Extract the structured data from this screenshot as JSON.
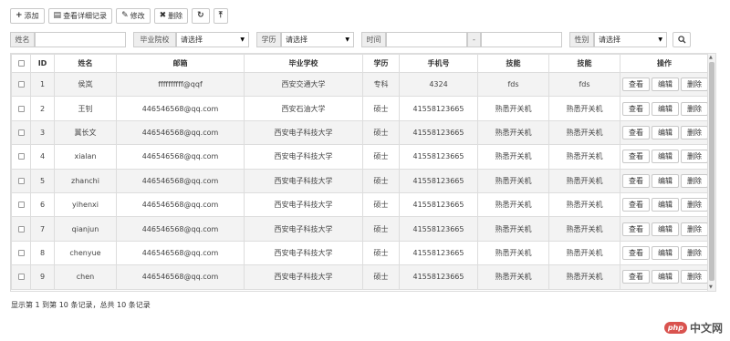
{
  "toolbar": {
    "add": "添加",
    "view_detail": "查看详细记录",
    "edit": "修改",
    "delete": "删除"
  },
  "filters": {
    "name_label": "姓名",
    "school_label": "毕业院校",
    "school_value": "请选择",
    "edu_label": "学历",
    "edu_value": "请选择",
    "time_label": "时间",
    "time_sep": "-",
    "gender_label": "性别",
    "gender_value": "请选择"
  },
  "table": {
    "headers": [
      "ID",
      "姓名",
      "邮箱",
      "毕业学校",
      "学历",
      "手机号",
      "技能",
      "技能",
      "操作"
    ],
    "rows": [
      {
        "id": "1",
        "name": "侯岚",
        "email": "ffffffffff@qqf",
        "school": "西安交通大学",
        "edu": "专科",
        "phone": "4324",
        "skill1": "fds",
        "skill2": "fds"
      },
      {
        "id": "2",
        "name": "王钊",
        "email": "446546568@qq.com",
        "school": "西安石油大学",
        "edu": "硕士",
        "phone": "41558123665",
        "skill1": "熟悉开关机",
        "skill2": "熟悉开关机"
      },
      {
        "id": "3",
        "name": "冀长文",
        "email": "446546568@qq.com",
        "school": "西安电子科技大学",
        "edu": "硕士",
        "phone": "41558123665",
        "skill1": "熟悉开关机",
        "skill2": "熟悉开关机"
      },
      {
        "id": "4",
        "name": "xialan",
        "email": "446546568@qq.com",
        "school": "西安电子科技大学",
        "edu": "硕士",
        "phone": "41558123665",
        "skill1": "熟悉开关机",
        "skill2": "熟悉开关机"
      },
      {
        "id": "5",
        "name": "zhanchi",
        "email": "446546568@qq.com",
        "school": "西安电子科技大学",
        "edu": "硕士",
        "phone": "41558123665",
        "skill1": "熟悉开关机",
        "skill2": "熟悉开关机"
      },
      {
        "id": "6",
        "name": "yihenxi",
        "email": "446546568@qq.com",
        "school": "西安电子科技大学",
        "edu": "硕士",
        "phone": "41558123665",
        "skill1": "熟悉开关机",
        "skill2": "熟悉开关机"
      },
      {
        "id": "7",
        "name": "qianjun",
        "email": "446546568@qq.com",
        "school": "西安电子科技大学",
        "edu": "硕士",
        "phone": "41558123665",
        "skill1": "熟悉开关机",
        "skill2": "熟悉开关机"
      },
      {
        "id": "8",
        "name": "chenyue",
        "email": "446546568@qq.com",
        "school": "西安电子科技大学",
        "edu": "硕士",
        "phone": "41558123665",
        "skill1": "熟悉开关机",
        "skill2": "熟悉开关机"
      },
      {
        "id": "9",
        "name": "chen",
        "email": "446546568@qq.com",
        "school": "西安电子科技大学",
        "edu": "硕士",
        "phone": "41558123665",
        "skill1": "熟悉开关机",
        "skill2": "熟悉开关机"
      }
    ],
    "actions": {
      "view": "查看",
      "edit": "编辑",
      "delete": "删除"
    }
  },
  "footer": {
    "text": "显示第 1 到第 10 条记录，总共 10 条记录"
  },
  "watermark": {
    "logo": "php",
    "text": "中文网"
  }
}
